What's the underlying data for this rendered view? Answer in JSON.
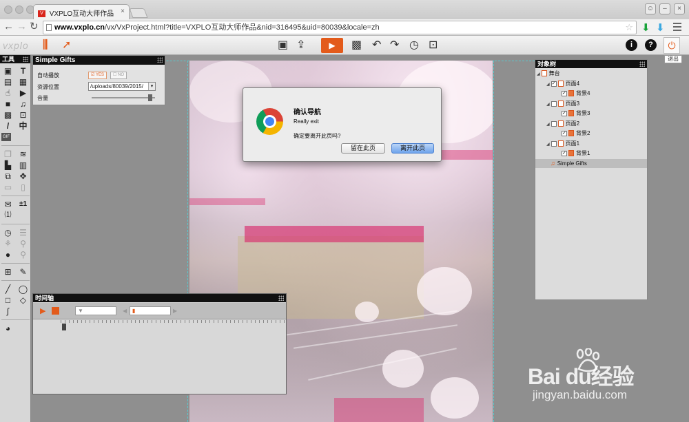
{
  "browser": {
    "tab_title": "VXPLO互动大师作品",
    "tab_close": "×",
    "url_host": "www.vxplo.cn",
    "url_path": "/vx/VxProject.html?title=VXPLO互动大师作品&nid=316495&uid=80039&locale=zh"
  },
  "app": {
    "logo": "vxplo",
    "exit_tooltip": "退出"
  },
  "tools_panel": {
    "title": "工具",
    "items": [
      {
        "icon": "image-icon",
        "glyph": "▣"
      },
      {
        "icon": "text-icon",
        "glyph": "T"
      },
      {
        "icon": "page-icon",
        "glyph": "▤"
      },
      {
        "icon": "document-icon",
        "glyph": "▦"
      },
      {
        "icon": "touch-icon",
        "glyph": "☝"
      },
      {
        "icon": "play-box-icon",
        "glyph": "▶"
      },
      {
        "icon": "video-icon",
        "glyph": "■"
      },
      {
        "icon": "music-icon",
        "glyph": "♫"
      },
      {
        "icon": "qrcode-icon",
        "glyph": "▩"
      },
      {
        "icon": "frame-icon",
        "glyph": "⊡"
      },
      {
        "icon": "brush-icon",
        "glyph": "/"
      },
      {
        "icon": "chinese-text-icon",
        "glyph": "中"
      },
      {
        "icon": "gif-icon",
        "glyph": "GIF"
      }
    ],
    "items2": [
      {
        "icon": "copy-icon",
        "glyph": "❐"
      },
      {
        "icon": "layers-icon",
        "glyph": "≋"
      },
      {
        "icon": "add-page-icon",
        "glyph": "▙"
      },
      {
        "icon": "slides-icon",
        "glyph": "▥"
      },
      {
        "icon": "stack-icon",
        "glyph": "⧉"
      },
      {
        "icon": "move-icon",
        "glyph": "✥"
      },
      {
        "icon": "monitor-icon",
        "glyph": "▭"
      },
      {
        "icon": "phone-icon",
        "glyph": "▯"
      }
    ],
    "items3": [
      {
        "icon": "comment-icon",
        "glyph": "✉"
      },
      {
        "icon": "plus-minus-icon",
        "glyph": "±1"
      },
      {
        "icon": "counter-icon",
        "glyph": "⑴"
      }
    ],
    "items4": [
      {
        "icon": "timer-icon",
        "glyph": "◷"
      },
      {
        "icon": "sliders-icon",
        "glyph": "☰"
      },
      {
        "icon": "runner-icon",
        "glyph": "⚘"
      },
      {
        "icon": "magic-wand-icon",
        "glyph": "⚲"
      },
      {
        "icon": "apple-icon",
        "glyph": "●"
      },
      {
        "icon": "pin-icon",
        "glyph": "⚲"
      }
    ],
    "items5": [
      {
        "icon": "table-icon",
        "glyph": "⊞"
      },
      {
        "icon": "edit-icon",
        "glyph": "✎"
      }
    ],
    "items6": [
      {
        "icon": "line-icon",
        "glyph": "╱"
      },
      {
        "icon": "ellipse-icon",
        "glyph": "◯"
      },
      {
        "icon": "rect-icon",
        "glyph": "□"
      },
      {
        "icon": "diamond-icon",
        "glyph": "◇"
      },
      {
        "icon": "curve-icon",
        "glyph": "∫"
      },
      {
        "icon": "blank-icon",
        "glyph": ""
      },
      {
        "icon": "share-icon",
        "glyph": "◕"
      }
    ]
  },
  "properties_panel": {
    "title": "Simple Gifts",
    "autoplay_label": "自动播放",
    "yes": "YES",
    "no": "NO",
    "source_label": "资源位置",
    "source_value": "/uploads/80039/2015/",
    "volume_label": "音量",
    "volume": 0.95
  },
  "timeline_panel": {
    "title": "时间轴"
  },
  "object_tree": {
    "title": "对象树",
    "stage": "舞台",
    "nodes": [
      {
        "label": "页面4",
        "checked": true
      },
      {
        "label": "背景4",
        "checked": true
      },
      {
        "label": "页面3",
        "checked": false
      },
      {
        "label": "背景3",
        "checked": true
      },
      {
        "label": "页面2",
        "checked": false
      },
      {
        "label": "背景2",
        "checked": true
      },
      {
        "label": "页面1",
        "checked": false
      },
      {
        "label": "背景1",
        "checked": true
      }
    ],
    "audio": "Simple Gifts"
  },
  "dialog": {
    "title": "确认导航",
    "message": "Really exit",
    "question": "确定要离开此页吗?",
    "stay_label": "留在此页",
    "leave_label": "离开此页"
  },
  "watermark": {
    "brand": "Bai du经验",
    "sub": "jingyan.baidu.com"
  }
}
